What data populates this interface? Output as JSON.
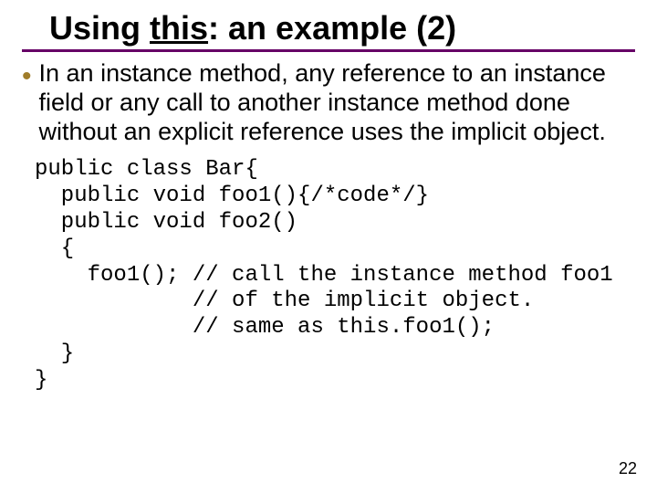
{
  "title_prefix": "Using ",
  "title_kw": "this",
  "title_suffix": ": an example (2)",
  "bullet_text": "In an instance method, any reference to an instance field or any call to another instance method done without an explicit reference uses the implicit object.",
  "code_lines": [
    "public class Bar{",
    "  public void foo1(){/*code*/}",
    "  public void foo2()",
    "  {",
    "    foo1(); // call the instance method foo1",
    "            // of the implicit object.",
    "            // same as this.foo1();",
    "  }",
    "}"
  ],
  "page_number": "22"
}
